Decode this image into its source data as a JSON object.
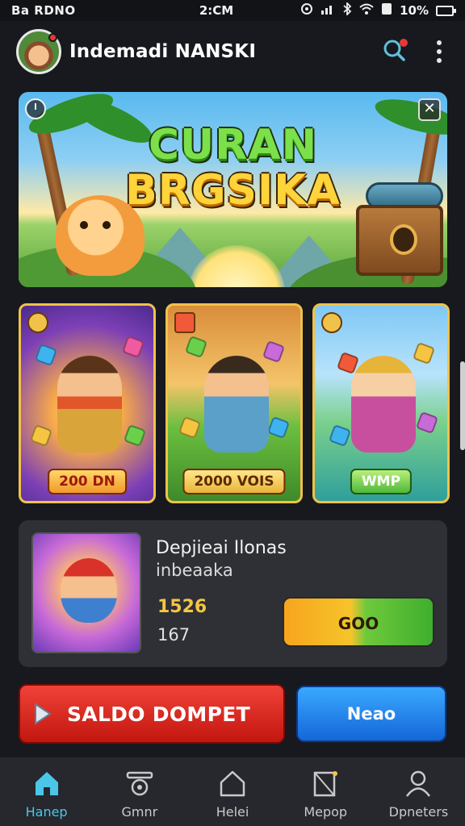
{
  "status_bar": {
    "left_text": "Ba RDNO",
    "time": "2:CM",
    "battery": "10%"
  },
  "header": {
    "title": "Indemadi NANSKI",
    "icons": [
      "avatar",
      "search-icon",
      "more-vert-icon"
    ]
  },
  "banner": {
    "title_line1": "CURAN",
    "title_line2": "BRGSIKA",
    "close_glyph": "✕"
  },
  "cards": [
    {
      "tag": "200 DN"
    },
    {
      "tag": "2000 VOIS"
    },
    {
      "tag": "WMP"
    }
  ],
  "offer": {
    "title": "Depjieai Ilonas",
    "subtitle": "inbeaaka",
    "price": "1526",
    "count": "167",
    "button_label": "GOO"
  },
  "actions": {
    "saldo_label": "SALDO DOMPET",
    "neao_label": "Neao"
  },
  "bottom_nav": {
    "items": [
      {
        "label": "Hanep",
        "icon": "home-icon",
        "active": true
      },
      {
        "label": "Gmnr",
        "icon": "game-icon",
        "active": false
      },
      {
        "label": "Helei",
        "icon": "house-outline-icon",
        "active": false
      },
      {
        "label": "Mepop",
        "icon": "map-pin-icon",
        "active": false
      },
      {
        "label": "Dpneters",
        "icon": "profile-icon",
        "active": false
      }
    ]
  },
  "colors": {
    "background": "#17191e",
    "accent_red": "#e53935",
    "accent_blue": "#1a7fe8",
    "accent_gold": "#f5c542",
    "nav_active": "#4cc6e8"
  }
}
